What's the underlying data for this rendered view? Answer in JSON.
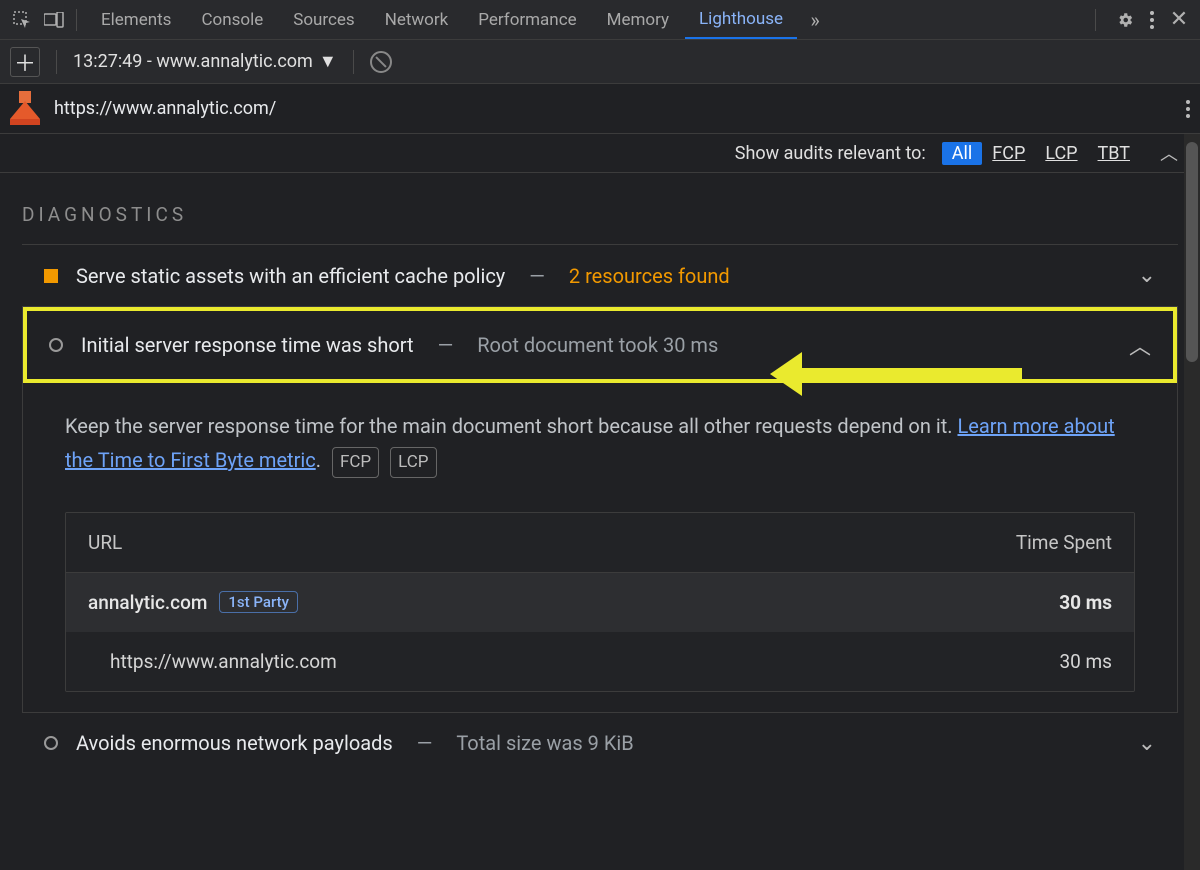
{
  "tabs": {
    "items": [
      "Elements",
      "Console",
      "Sources",
      "Network",
      "Performance",
      "Memory",
      "Lighthouse"
    ],
    "active": "Lighthouse"
  },
  "subbar": {
    "record_label": "13:27:49 - www.annalytic.com"
  },
  "report": {
    "url": "https://www.annalytic.com/"
  },
  "filters": {
    "label": "Show audits relevant to:",
    "items": [
      "All",
      "FCP",
      "LCP",
      "TBT"
    ],
    "active": "All"
  },
  "section": {
    "title": "DIAGNOSTICS"
  },
  "audits": {
    "cache": {
      "title": "Serve static assets with an efficient cache policy",
      "subtitle": "2 resources found"
    },
    "ttfb": {
      "title": "Initial server response time was short",
      "subtitle": "Root document took 30 ms",
      "description_pre": "Keep the server response time for the main document short because all other requests depend on it. ",
      "link_text": "Learn more about the Time to First Byte metric",
      "badges": [
        "FCP",
        "LCP"
      ],
      "table": {
        "head_url": "URL",
        "head_time": "Time Spent",
        "group_host": "annalytic.com",
        "group_badge": "1st Party",
        "group_time": "30 ms",
        "row_url": "https://www.annalytic.com",
        "row_time": "30 ms"
      }
    },
    "payload": {
      "title": "Avoids enormous network payloads",
      "subtitle": "Total size was 9 KiB"
    }
  }
}
